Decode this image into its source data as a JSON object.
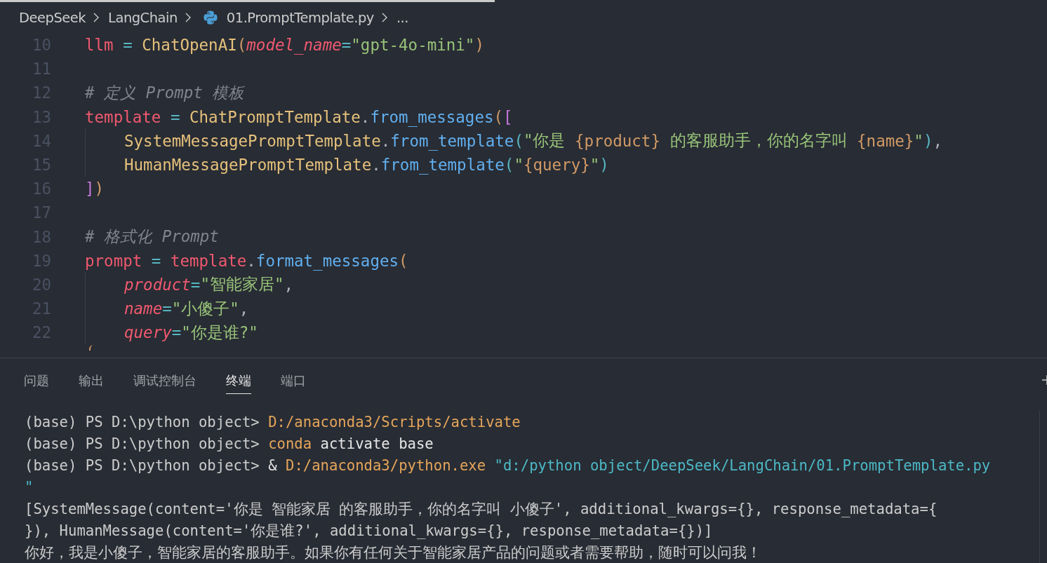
{
  "breadcrumb": [
    {
      "kind": "folder",
      "label": "DeepSeek"
    },
    {
      "kind": "folder",
      "label": "LangChain"
    },
    {
      "kind": "python-file",
      "label": "01.PromptTemplate.py"
    },
    {
      "kind": "more",
      "label": "..."
    }
  ],
  "code_lines": [
    {
      "number": "10",
      "indented": false,
      "tokens": [
        {
          "kind": "var",
          "text": "llm"
        },
        {
          "kind": "op",
          "text": " = "
        },
        {
          "kind": "class",
          "text": "ChatOpenAI"
        },
        {
          "kind": "bracket1",
          "text": "("
        },
        {
          "kind": "param",
          "text": "model_name"
        },
        {
          "kind": "op",
          "text": "="
        },
        {
          "kind": "string",
          "text": "\"gpt-4o-mini\""
        },
        {
          "kind": "bracket1",
          "text": ")"
        }
      ]
    },
    {
      "number": "11",
      "indented": false
    },
    {
      "number": "12",
      "indented": false,
      "tokens": [
        {
          "kind": "comment",
          "text": "# 定义 Prompt 模板"
        }
      ]
    },
    {
      "number": "13",
      "indented": false,
      "tokens": [
        {
          "kind": "var",
          "text": "template"
        },
        {
          "kind": "op",
          "text": " = "
        },
        {
          "kind": "class",
          "text": "ChatPromptTemplate"
        },
        {
          "kind": "punct",
          "text": "."
        },
        {
          "kind": "func",
          "text": "from_messages"
        },
        {
          "kind": "bracket1",
          "text": "("
        },
        {
          "kind": "bracket2",
          "text": "["
        }
      ]
    },
    {
      "number": "14",
      "indented": true,
      "tokens": [
        {
          "kind": "class",
          "text": "SystemMessagePromptTemplate"
        },
        {
          "kind": "punct",
          "text": "."
        },
        {
          "kind": "func",
          "text": "from_template"
        },
        {
          "kind": "bracket3",
          "text": "("
        },
        {
          "kind": "string",
          "text": "\"你是 "
        },
        {
          "kind": "interp",
          "text": "{product}"
        },
        {
          "kind": "string",
          "text": " 的客服助手，你的名字叫 "
        },
        {
          "kind": "interp",
          "text": "{name}"
        },
        {
          "kind": "string",
          "text": "\""
        },
        {
          "kind": "bracket3",
          "text": ")"
        },
        {
          "kind": "punct",
          "text": ","
        }
      ]
    },
    {
      "number": "15",
      "indented": true,
      "tokens": [
        {
          "kind": "class",
          "text": "HumanMessagePromptTemplate"
        },
        {
          "kind": "punct",
          "text": "."
        },
        {
          "kind": "func",
          "text": "from_template"
        },
        {
          "kind": "bracket3",
          "text": "("
        },
        {
          "kind": "string",
          "text": "\""
        },
        {
          "kind": "interp",
          "text": "{query}"
        },
        {
          "kind": "string",
          "text": "\""
        },
        {
          "kind": "bracket3",
          "text": ")"
        }
      ]
    },
    {
      "number": "16",
      "indented": false,
      "tokens": [
        {
          "kind": "bracket2",
          "text": "]"
        },
        {
          "kind": "bracket1",
          "text": ")"
        }
      ]
    },
    {
      "number": "17",
      "indented": false
    },
    {
      "number": "18",
      "indented": false,
      "tokens": [
        {
          "kind": "comment",
          "text": "# 格式化 Prompt"
        }
      ]
    },
    {
      "number": "19",
      "indented": false,
      "tokens": [
        {
          "kind": "var",
          "text": "prompt"
        },
        {
          "kind": "op",
          "text": " = "
        },
        {
          "kind": "var",
          "text": "template"
        },
        {
          "kind": "punct",
          "text": "."
        },
        {
          "kind": "func",
          "text": "format_messages"
        },
        {
          "kind": "bracket1",
          "text": "("
        }
      ]
    },
    {
      "number": "20",
      "indented": true,
      "tokens": [
        {
          "kind": "param",
          "text": "product"
        },
        {
          "kind": "op",
          "text": "="
        },
        {
          "kind": "string",
          "text": "\"智能家居\""
        },
        {
          "kind": "punct",
          "text": ","
        }
      ]
    },
    {
      "number": "21",
      "indented": true,
      "tokens": [
        {
          "kind": "param",
          "text": "name"
        },
        {
          "kind": "op",
          "text": "="
        },
        {
          "kind": "string",
          "text": "\"小傻子\""
        },
        {
          "kind": "punct",
          "text": ","
        }
      ]
    },
    {
      "number": "22",
      "indented": true,
      "tokens": [
        {
          "kind": "param",
          "text": "query"
        },
        {
          "kind": "op",
          "text": "="
        },
        {
          "kind": "string",
          "text": "\"你是谁?\""
        }
      ]
    }
  ],
  "panel_tabs": [
    {
      "label": "问题",
      "selected": false
    },
    {
      "label": "输出",
      "selected": false
    },
    {
      "label": "调试控制台",
      "selected": false
    },
    {
      "label": "终端",
      "selected": true
    },
    {
      "label": "端口",
      "selected": false
    }
  ],
  "terminal_lines": [
    [
      {
        "kind": "prompt",
        "text": "(base) PS D:\\python object> "
      },
      {
        "kind": "cmd",
        "text": "D:/anaconda3/Scripts/activate"
      }
    ],
    [
      {
        "kind": "prompt",
        "text": "(base) PS D:\\python object> "
      },
      {
        "kind": "cmd",
        "text": "conda"
      },
      {
        "kind": "arg",
        "text": " activate base"
      }
    ],
    [
      {
        "kind": "prompt",
        "text": "(base) PS D:\\python object> "
      },
      {
        "kind": "arg",
        "text": "& "
      },
      {
        "kind": "cmd",
        "text": "D:/anaconda3/python.exe"
      },
      {
        "kind": "path",
        "text": " \"d:/python object/DeepSeek/LangChain/01.PromptTemplate.py"
      }
    ],
    [
      {
        "kind": "path",
        "text": "\""
      }
    ],
    [
      {
        "kind": "output",
        "text": "[SystemMessage(content='你是 智能家居 的客服助手，你的名字叫 小傻子', additional_kwargs={}, response_metadata={"
      }
    ],
    [
      {
        "kind": "output",
        "text": "}), HumanMessage(content='你是谁?', additional_kwargs={}, response_metadata={})]"
      }
    ],
    [
      {
        "kind": "output",
        "text": "你好，我是小傻子，智能家居的客服助手。如果你有任何关于智能家居产品的问题或者需要帮助，随时可以问我！"
      }
    ]
  ]
}
